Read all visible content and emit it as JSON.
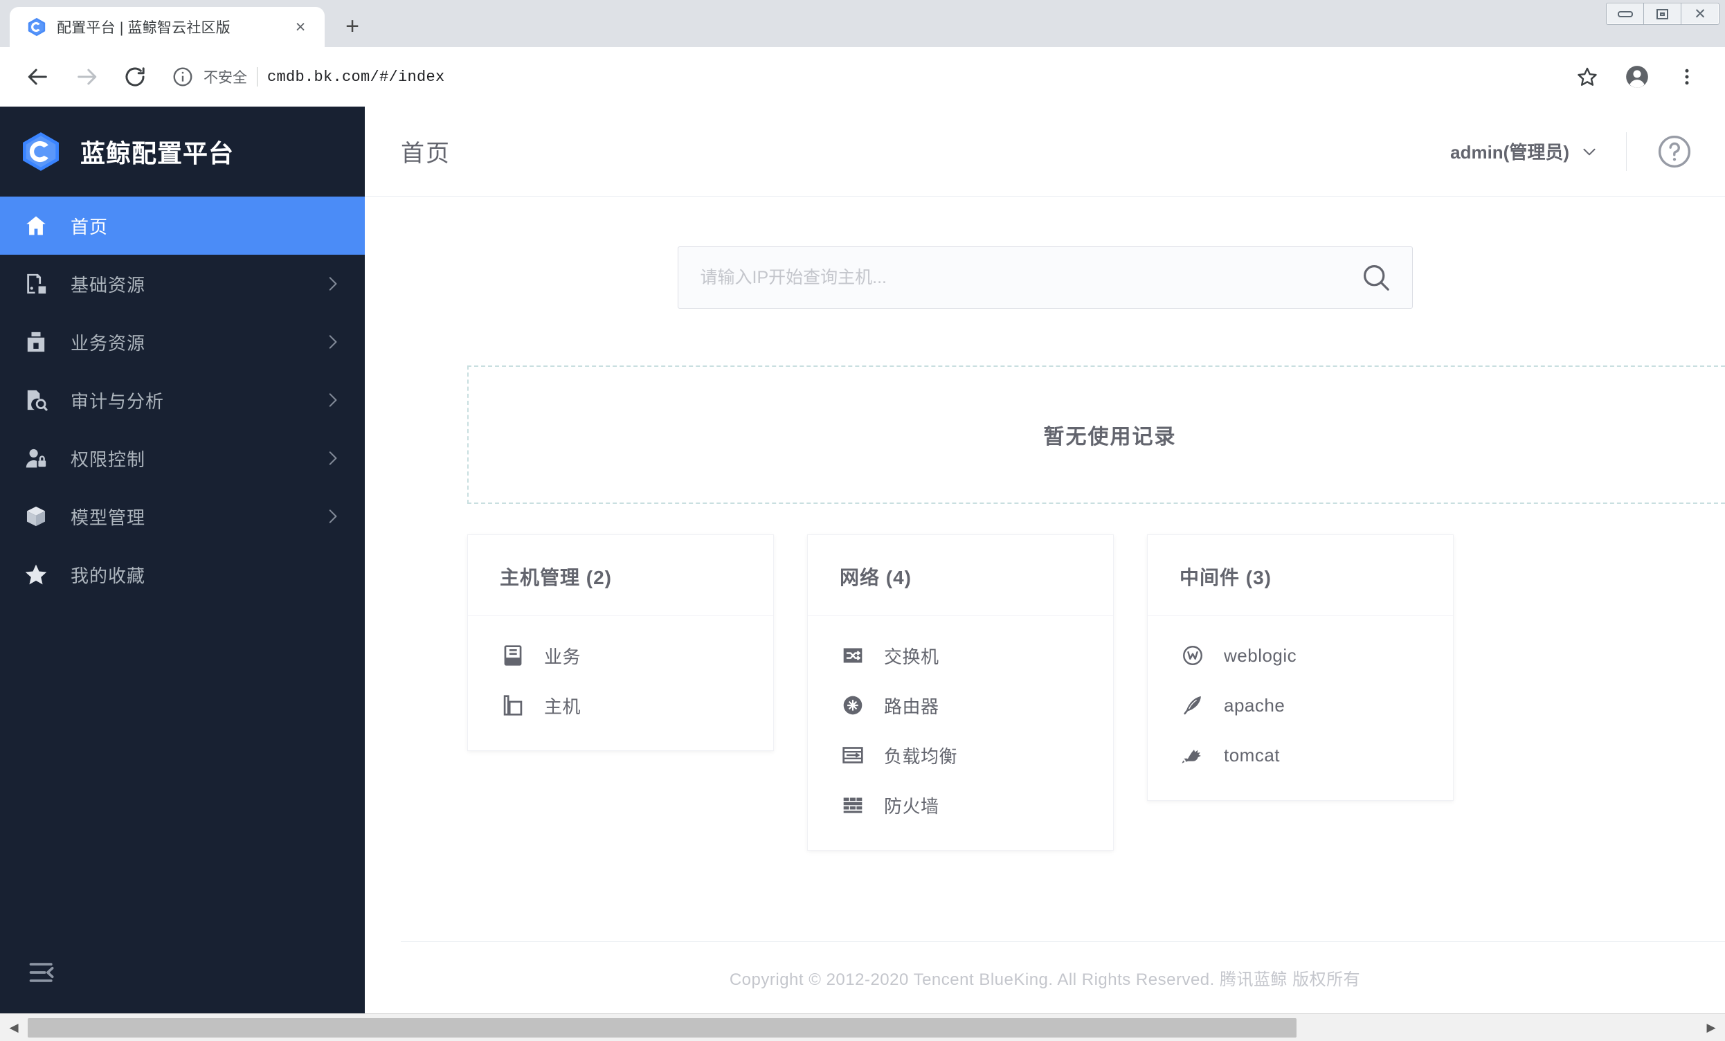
{
  "browser": {
    "tab": {
      "title": "配置平台 | 蓝鲸智云社区版",
      "favicon": "bk-hex-logo-icon",
      "close": "×"
    },
    "new_tab": "+",
    "window_controls": {
      "minimize": "minimize-icon",
      "maximize": "maximize-icon",
      "close": "✕"
    },
    "nav": {
      "back": "back-arrow-icon",
      "forward": "forward-arrow-icon",
      "reload": "reload-icon"
    },
    "omnibox": {
      "security_label": "不安全",
      "info_icon": "info-circle-icon",
      "url": "cmdb.bk.com/#/index"
    },
    "actions": {
      "bookmark": "star-icon",
      "profile": "account-circle-icon",
      "menu": "three-dots-menu-icon"
    }
  },
  "app": {
    "brand": {
      "logo": "bk-hex-logo-icon",
      "name": "蓝鲸配置平台"
    },
    "sidebar": {
      "items": [
        {
          "label": "首页",
          "icon": "home-icon",
          "active": true,
          "chevron": false
        },
        {
          "label": "基础资源",
          "icon": "resource-icon",
          "active": false,
          "chevron": true
        },
        {
          "label": "业务资源",
          "icon": "business-icon",
          "active": false,
          "chevron": true
        },
        {
          "label": "审计与分析",
          "icon": "audit-icon",
          "active": false,
          "chevron": true
        },
        {
          "label": "权限控制",
          "icon": "permission-icon",
          "active": false,
          "chevron": true
        },
        {
          "label": "模型管理",
          "icon": "model-cube-icon",
          "active": false,
          "chevron": true
        },
        {
          "label": "我的收藏",
          "icon": "star-icon",
          "active": false,
          "chevron": false
        }
      ],
      "collapse": "collapse-menu-icon"
    },
    "topbar": {
      "title": "首页",
      "user": "admin(管理员)",
      "user_chevron": "chevron-down-icon",
      "help": "help-circle-icon"
    },
    "search": {
      "placeholder": "请输入IP开始查询主机...",
      "value": "",
      "icon": "search-icon"
    },
    "recent": {
      "empty_text": "暂无使用记录"
    },
    "cards": [
      {
        "title": "主机管理 (2)",
        "items": [
          {
            "label": "业务",
            "icon": "business-set-icon"
          },
          {
            "label": "主机",
            "icon": "host-icon"
          }
        ]
      },
      {
        "title": "网络 (4)",
        "items": [
          {
            "label": "交换机",
            "icon": "switch-icon"
          },
          {
            "label": "路由器",
            "icon": "router-icon"
          },
          {
            "label": "负载均衡",
            "icon": "load-balancer-icon"
          },
          {
            "label": "防火墙",
            "icon": "firewall-icon"
          }
        ]
      },
      {
        "title": "中间件 (3)",
        "items": [
          {
            "label": "weblogic",
            "icon": "weblogic-icon"
          },
          {
            "label": "apache",
            "icon": "apache-feather-icon"
          },
          {
            "label": "tomcat",
            "icon": "tomcat-cat-icon"
          }
        ]
      }
    ],
    "footer": "Copyright © 2012-2020 Tencent BlueKing. All Rights Reserved. 腾讯蓝鲸 版权所有"
  },
  "colors": {
    "sidebar_bg": "#182132",
    "sidebar_active": "#4b8cf7",
    "brand_blue": "#3a84ff",
    "text_primary": "#63656e",
    "text_placeholder": "#c4c6cc",
    "dashed_border": "#c9dfe0"
  }
}
